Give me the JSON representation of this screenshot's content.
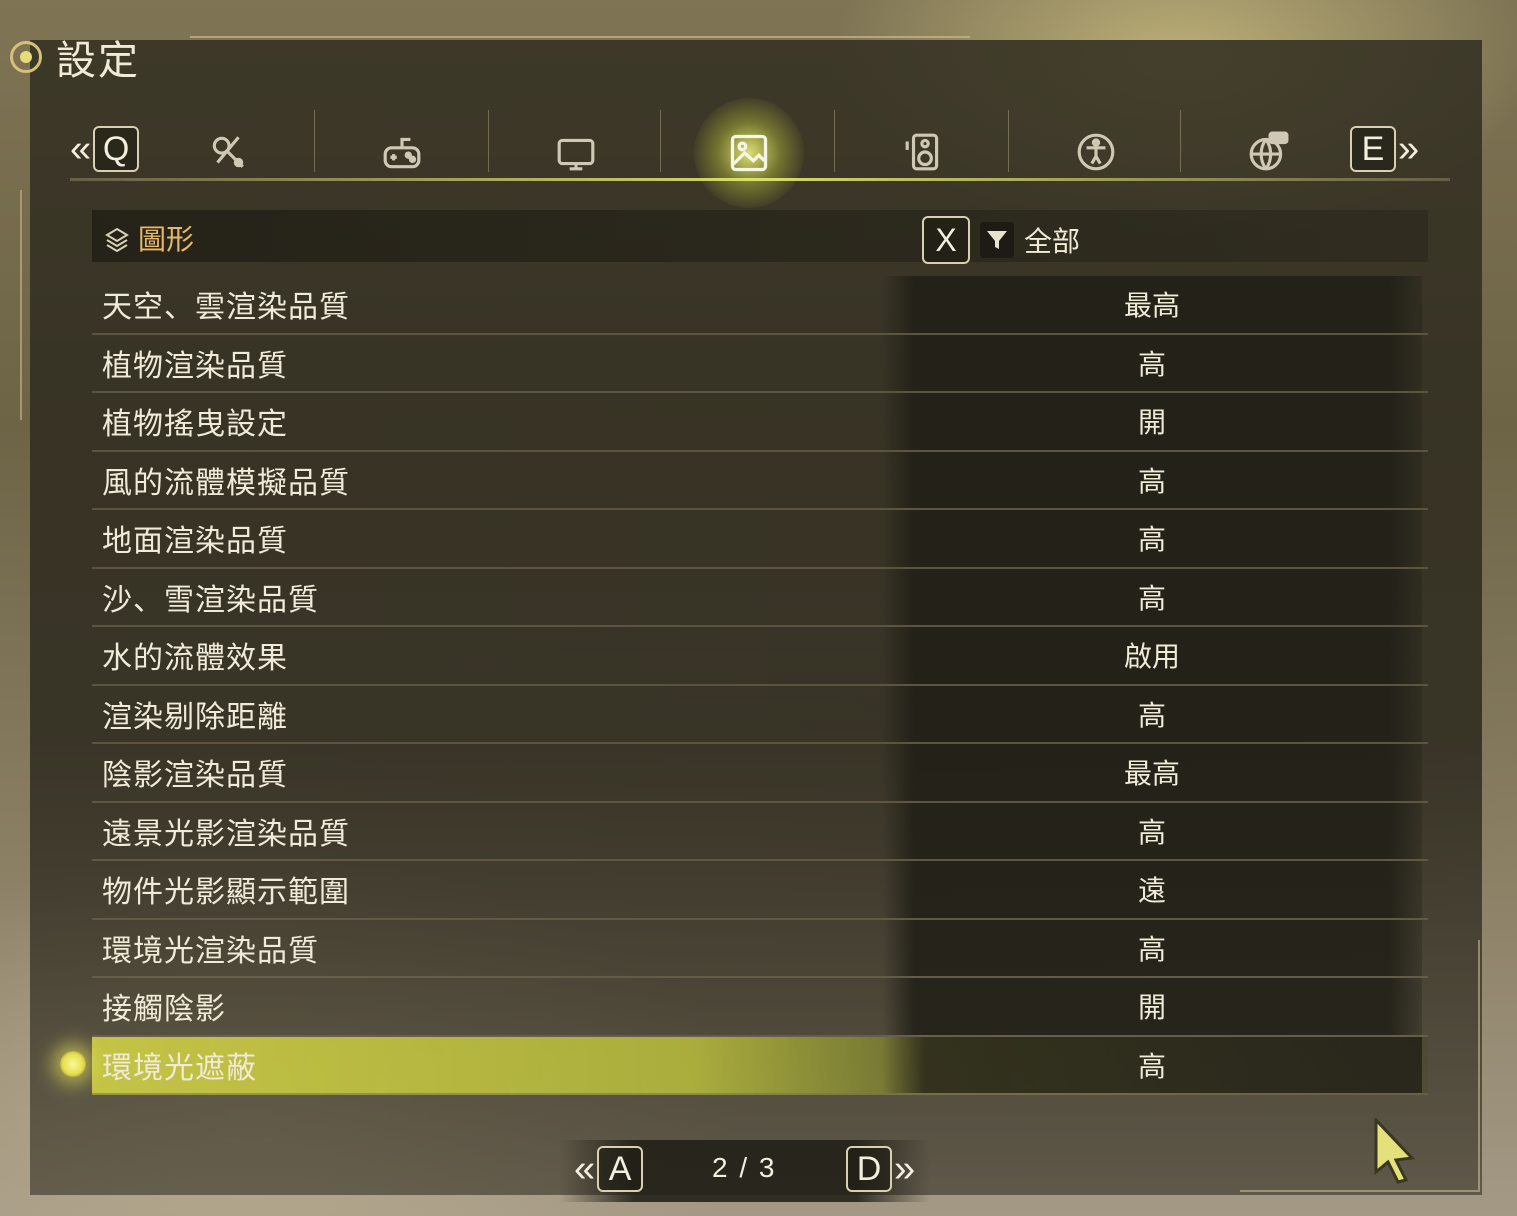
{
  "header": {
    "title": "設定"
  },
  "tabs": {
    "prev_key": "Q",
    "next_key": "E",
    "prev_chevron": "«",
    "next_chevron": "»",
    "items": [
      {
        "icon": "wrench-gear-icon"
      },
      {
        "icon": "gamepad-icon"
      },
      {
        "icon": "tv-icon"
      },
      {
        "icon": "image-icon",
        "active": true
      },
      {
        "icon": "speaker-icon"
      },
      {
        "icon": "accessibility-icon"
      },
      {
        "icon": "globe-chat-icon"
      }
    ]
  },
  "section": {
    "title": "圖形",
    "filter_key": "X",
    "filter_label": "全部"
  },
  "settings": [
    {
      "name": "天空、雲渲染品質",
      "value": "最高"
    },
    {
      "name": "植物渲染品質",
      "value": "高"
    },
    {
      "name": "植物搖曳設定",
      "value": "開"
    },
    {
      "name": "風的流體模擬品質",
      "value": "高"
    },
    {
      "name": "地面渲染品質",
      "value": "高"
    },
    {
      "name": "沙、雪渲染品質",
      "value": "高"
    },
    {
      "name": "水的流體效果",
      "value": "啟用"
    },
    {
      "name": "渲染剔除距離",
      "value": "高"
    },
    {
      "name": "陰影渲染品質",
      "value": "最高"
    },
    {
      "name": "遠景光影渲染品質",
      "value": "高"
    },
    {
      "name": "物件光影顯示範圍",
      "value": "遠"
    },
    {
      "name": "環境光渲染品質",
      "value": "高"
    },
    {
      "name": "接觸陰影",
      "value": "開"
    },
    {
      "name": "環境光遮蔽",
      "value": "高",
      "selected": true
    }
  ],
  "pager": {
    "prev_key": "A",
    "next_key": "D",
    "page": "2 / 3"
  },
  "colors": {
    "accent": "#e6e05a",
    "section_title": "#e8b86a",
    "text": "#f0ead8"
  }
}
